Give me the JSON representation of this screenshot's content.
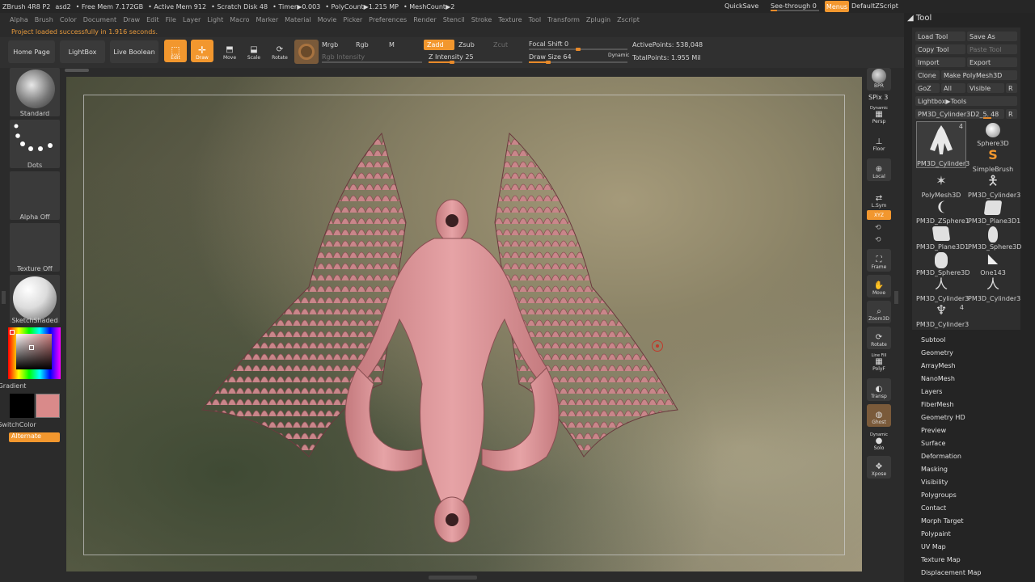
{
  "menubar": {
    "app": "ZBrush 4R8 P2",
    "doc": "asd2",
    "free_mem": "• Free Mem 7.172GB",
    "active_mem": "• Active Mem 912",
    "scratch": "• Scratch Disk 48",
    "timer": "• Timer▶0.003",
    "polycount": "• PolyCount▶1.215 MP",
    "meshcount": "• MeshCount▶2",
    "items": [
      "Alpha",
      "Brush",
      "Color",
      "Document",
      "Draw",
      "Edit",
      "File",
      "Layer",
      "Light",
      "Macro",
      "Marker",
      "Material",
      "Movie",
      "Picker",
      "Preferences",
      "Render",
      "Stencil",
      "Stroke",
      "Texture",
      "Tool",
      "Transform",
      "Zplugin",
      "Zscript"
    ],
    "quicksave": "QuickSave",
    "see_through": "See-through",
    "see_through_value": "0",
    "menus": "Menus",
    "default_zscript": "DefaultZScript"
  },
  "notification": "Project loaded successfully in 1.916 seconds.",
  "shelf": {
    "home_page": "Home Page",
    "lightbox": "LightBox",
    "live_boolean": "Live Boolean",
    "edit": "Edit",
    "draw": "Draw",
    "move": "Move",
    "scale": "Scale",
    "rotate": "Rotate",
    "mrgb": "Mrgb",
    "rgb": "Rgb",
    "m": "M",
    "zadd": "Zadd",
    "zsub": "Zsub",
    "zcut": "Zcut",
    "rgb_intensity": "Rgb Intensity",
    "z_intensity_label": "Z Intensity",
    "z_intensity": "25",
    "z_intensity_level": 0.25,
    "focal_shift_label": "Focal Shift",
    "focal_shift": "0",
    "focal_shift_level": 0.5,
    "draw_size_label": "Draw Size",
    "draw_size": "64",
    "draw_size_level": 0.2,
    "dynamic": "Dynamic",
    "active_points": "ActivePoints: 538,048",
    "total_points": "TotalPoints: 1.955 Mil"
  },
  "leftpanel": {
    "brush": "Standard",
    "stroke": "Dots",
    "alpha": "Alpha Off",
    "texture": "Texture Off",
    "material": "SketchShaded",
    "gradient": "Gradient",
    "switch_color": "SwitchColor",
    "alternate": "Alternate",
    "main_color": "#d98a8a"
  },
  "rightstrip": {
    "bpr": "BPR",
    "spix": "SPix 3",
    "dynamic": "Dynamic",
    "persp": "Persp",
    "floor": "Floor",
    "local": "Local",
    "lsym": "L.Sym",
    "xyz": "XYZ",
    "frame": "Frame",
    "move": "Move",
    "zoom3d": "Zoom3D",
    "rotate": "Rotate",
    "linefill": "Line Fill",
    "polyf": "PolyF",
    "transp": "Transp",
    "ghost": "Ghost",
    "dynamic2": "Dynamic",
    "solo": "Solo",
    "xpose": "Xpose"
  },
  "tool": {
    "title": "Tool",
    "load_tool": "Load Tool",
    "save_as": "Save As",
    "copy_tool": "Copy Tool",
    "paste_tool": "Paste Tool",
    "import": "Import",
    "export": "Export",
    "clone": "Clone",
    "make_polymesh": "Make PolyMesh3D",
    "goz": "GoZ",
    "all": "All",
    "visible": "Visible",
    "r": "R",
    "lightbox_tools": "Lightbox▶Tools",
    "current_tool": "PM3D_Cylinder3D2_5.",
    "current_value": "48",
    "r2": "R",
    "thumbs": [
      {
        "label": "PM3D_Cylinder3",
        "count": "4"
      },
      {
        "label": "Sphere3D",
        "count": ""
      },
      {
        "label": "",
        "count": ""
      },
      {
        "label": "SimpleBrush",
        "count": ""
      },
      {
        "label": "PolyMesh3D",
        "count": ""
      },
      {
        "label": "PM3D_Cylinder3",
        "count": ""
      },
      {
        "label": "PM3D_ZSphere1",
        "count": ""
      },
      {
        "label": "PM3D_Plane3D1",
        "count": ""
      },
      {
        "label": "PM3D_Plane3D1",
        "count": ""
      },
      {
        "label": "PM3D_Sphere3D",
        "count": ""
      },
      {
        "label": "PM3D_Sphere3D",
        "count": ""
      },
      {
        "label": "One143",
        "count": ""
      },
      {
        "label": "PM3D_Cylinder3",
        "count": ""
      },
      {
        "label": "PM3D_Cylinder3",
        "count": ""
      },
      {
        "label": "PM3D_Cylinder3",
        "count": "4"
      }
    ],
    "sections": [
      "Subtool",
      "Geometry",
      "ArrayMesh",
      "NanoMesh",
      "Layers",
      "FiberMesh",
      "Geometry HD",
      "Preview",
      "Surface",
      "Deformation",
      "Masking",
      "Visibility",
      "Polygroups",
      "Contact",
      "Morph Target",
      "Polypaint",
      "UV Map",
      "Texture Map",
      "Displacement Map"
    ]
  }
}
